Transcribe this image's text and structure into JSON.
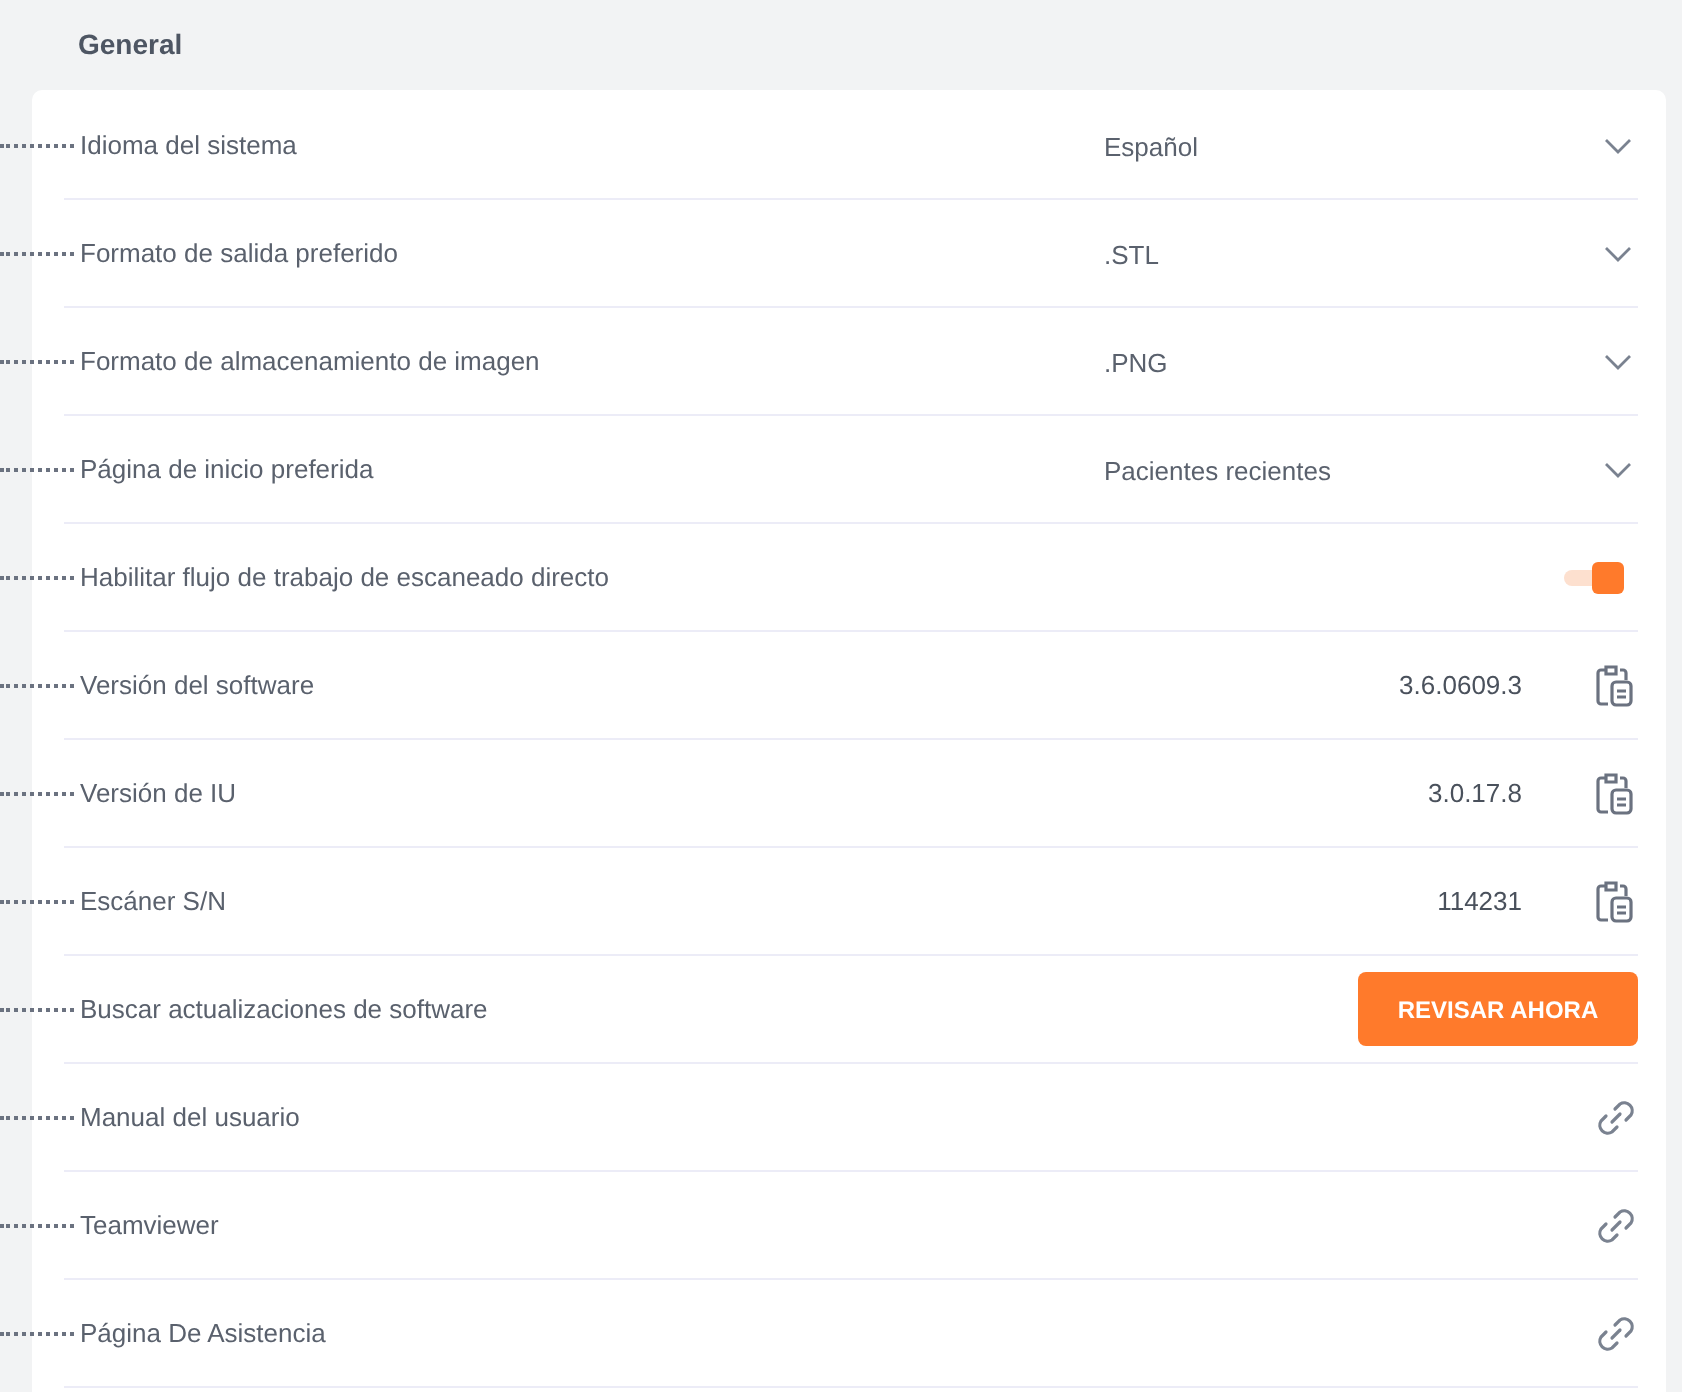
{
  "section": {
    "title": "General"
  },
  "settings": [
    {
      "kind": "dropdown",
      "label": "Idioma del sistema",
      "value": "Español"
    },
    {
      "kind": "dropdown",
      "label": "Formato de salida preferido",
      "value": ".STL"
    },
    {
      "kind": "dropdown",
      "label": "Formato de almacenamiento de imagen",
      "value": ".PNG"
    },
    {
      "kind": "dropdown",
      "label": "Página de inicio preferida",
      "value": "Pacientes recientes"
    },
    {
      "kind": "toggle",
      "label": "Habilitar flujo de trabajo de escaneado directo",
      "on": true
    },
    {
      "kind": "copy",
      "label": "Versión del software",
      "value": "3.6.0609.3"
    },
    {
      "kind": "copy",
      "label": "Versión de IU",
      "value": "3.0.17.8"
    },
    {
      "kind": "copy",
      "label": "Escáner S/N",
      "value": "114231"
    },
    {
      "kind": "button",
      "label": "Buscar actualizaciones de software",
      "button": "REVISAR AHORA"
    },
    {
      "kind": "link",
      "label": "Manual del usuario"
    },
    {
      "kind": "link",
      "label": "Teamviewer"
    },
    {
      "kind": "link",
      "label": "Página De Asistencia"
    }
  ]
}
